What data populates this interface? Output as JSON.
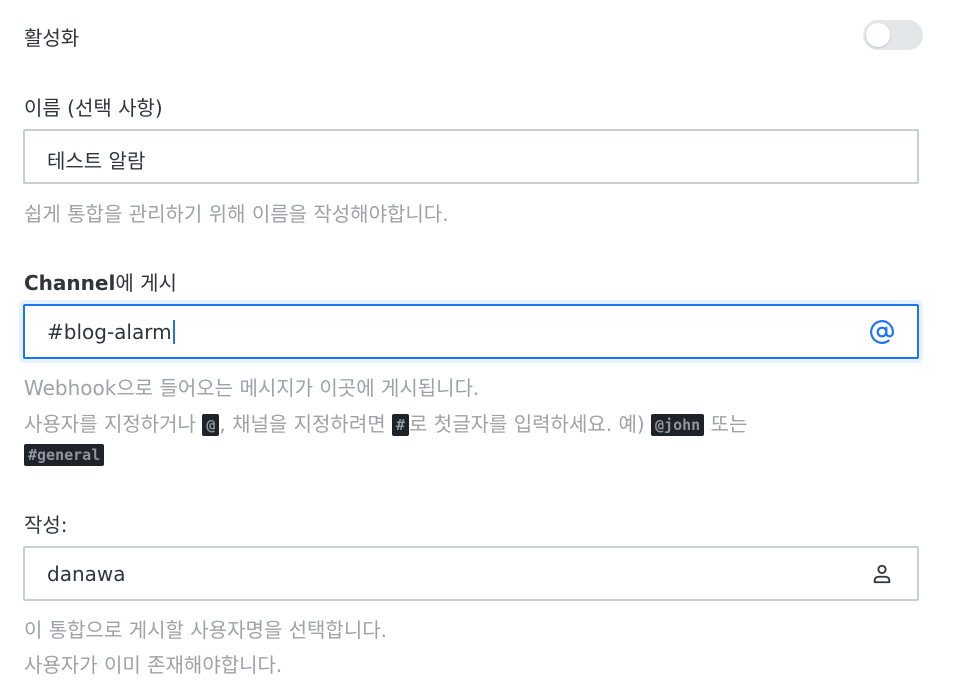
{
  "enable": {
    "label": "활성화",
    "on": false
  },
  "name": {
    "label": "이름 (선택 사항)",
    "value": "테스트 알람",
    "hint": "쉽게 통합을 관리하기 위해 이름을 작성해야합니다."
  },
  "channel": {
    "label_strong": "Channel",
    "label_rest": "에 게시",
    "value": "#blog-alarm",
    "icon": "at-icon",
    "hint_line1": "Webhook으로 들어오는 메시지가 이곳에 게시됩니다.",
    "hint_part1": "사용자를 지정하거나 ",
    "code_at": "@",
    "hint_part2": ", 채널을 지정하려면 ",
    "code_hash": "#",
    "hint_part3": "로 첫글자를 입력하세요. 예) ",
    "code_john": "@john",
    "hint_part4": " 또는",
    "code_general": "#general"
  },
  "author": {
    "label": "작성:",
    "value": "danawa",
    "icon": "user-icon",
    "hint_line1": "이 통합으로 게시할 사용자명을 선택합니다.",
    "hint_line2": "사용자가 이미 존재해야합니다."
  },
  "colors": {
    "accent": "#1d74f5",
    "text": "#2f343d",
    "hint": "#9ea2a8",
    "border": "#cbced1"
  }
}
